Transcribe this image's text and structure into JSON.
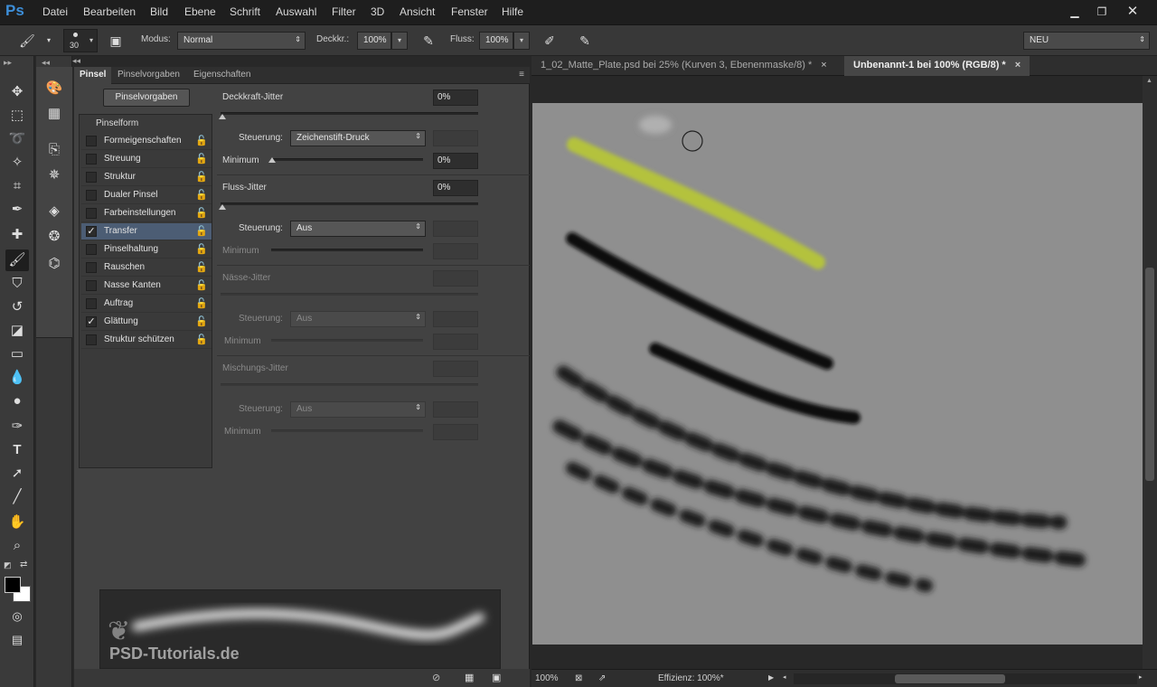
{
  "app": {
    "logo": "Ps",
    "menu": [
      "Datei",
      "Bearbeiten",
      "Bild",
      "Ebene",
      "Schrift",
      "Auswahl",
      "Filter",
      "3D",
      "Ansicht",
      "Fenster",
      "Hilfe"
    ],
    "window_buttons": [
      "minimize",
      "restore",
      "close"
    ]
  },
  "options": {
    "brush_size": "30",
    "mode_label": "Modus:",
    "mode_value": "Normal",
    "opacity_label": "Deckkr.:",
    "opacity_value": "100%",
    "flow_label": "Fluss:",
    "flow_value": "100%",
    "workspace": "NEU"
  },
  "panel": {
    "tabs": [
      "Pinsel",
      "Pinselvorgaben",
      "Eigenschaften"
    ],
    "presets_button": "Pinselvorgaben",
    "list_header": "Pinselform",
    "items": [
      {
        "label": "Formeigenschaften",
        "checked": false
      },
      {
        "label": "Streuung",
        "checked": false
      },
      {
        "label": "Struktur",
        "checked": false
      },
      {
        "label": "Dualer Pinsel",
        "checked": false
      },
      {
        "label": "Farbeinstellungen",
        "checked": false
      },
      {
        "label": "Transfer",
        "checked": true
      },
      {
        "label": "Pinselhaltung",
        "checked": false
      },
      {
        "label": "Rauschen",
        "checked": false
      },
      {
        "label": "Nasse Kanten",
        "checked": false
      },
      {
        "label": "Auftrag",
        "checked": false
      },
      {
        "label": "Glättung",
        "checked": true
      },
      {
        "label": "Struktur schützen",
        "checked": false
      }
    ],
    "opacity_jitter": {
      "label": "Deckkraft-Jitter",
      "value": "0%",
      "control_label": "Steuerung:",
      "control": "Zeichenstift-Druck",
      "minimum_label": "Minimum",
      "minimum": "0%"
    },
    "flow_jitter": {
      "label": "Fluss-Jitter",
      "value": "0%",
      "control_label": "Steuerung:",
      "control": "Aus",
      "minimum_label": "Minimum"
    },
    "wet_jitter": {
      "label": "Nässe-Jitter",
      "control_label": "Steuerung:",
      "control": "Aus",
      "minimum_label": "Minimum"
    },
    "mix_jitter": {
      "label": "Mischungs-Jitter",
      "control_label": "Steuerung:",
      "control": "Aus",
      "minimum_label": "Minimum"
    },
    "watermark": "PSD-Tutorials.de"
  },
  "document": {
    "tabs": [
      {
        "label": "1_02_Matte_Plate.psd bei 25% (Kurven 3, Ebenenmaske/8) *",
        "active": false
      },
      {
        "label": "Unbenannt-1 bei 100% (RGB/8) *",
        "active": true
      }
    ],
    "close_glyph": "×",
    "status_zoom": "100%",
    "status_info": "Effizienz: 100%*",
    "stroke_colors": {
      "yellow": "#b4c23c",
      "black": "#111111"
    }
  }
}
